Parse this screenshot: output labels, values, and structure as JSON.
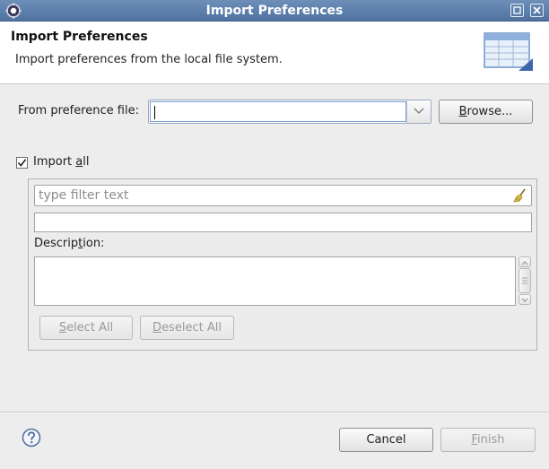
{
  "window": {
    "title": "Import Preferences"
  },
  "header": {
    "title": "Import Preferences",
    "description": "Import preferences from the local file system."
  },
  "file": {
    "label": "From preference file:",
    "value": "",
    "browse_label_pre": "",
    "browse_label_mn": "B",
    "browse_label_post": "rowse..."
  },
  "import_all": {
    "checked": true,
    "label_pre": "Import ",
    "label_mn": "a",
    "label_post": "ll"
  },
  "filter": {
    "placeholder": "type filter text"
  },
  "description": {
    "label_pre": "Descrip",
    "label_mn": "t",
    "label_post": "ion:",
    "text": ""
  },
  "buttons": {
    "select_all_mn": "S",
    "select_all_post": "elect All",
    "deselect_all_mn": "D",
    "deselect_all_post": "eselect All",
    "cancel": "Cancel",
    "finish_mn": "F",
    "finish_post": "inish"
  },
  "colors": {
    "titlebar": "#5a7daa",
    "disabled_text": "#9a9a9a"
  },
  "icons": {
    "app": "eclipse-gear-icon",
    "banner": "wizard-table-icon",
    "filter_clear": "broom-icon",
    "help": "help-icon"
  }
}
